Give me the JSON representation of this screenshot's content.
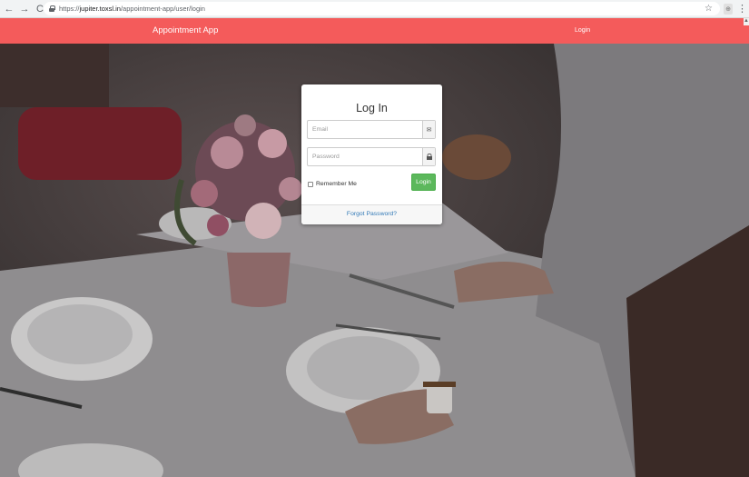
{
  "browser": {
    "url_scheme": "https://",
    "url_host": "jupiter.toxsl.in",
    "url_path": "/appointment-app/user/login",
    "back_glyph": "←",
    "forward_glyph": "→",
    "reload_glyph": "C",
    "star_glyph": "☆",
    "menu_glyph": "⋮"
  },
  "navbar": {
    "brand": "Appointment App",
    "login_link": "Login",
    "color": "#f45b5b"
  },
  "login_card": {
    "title": "Log In",
    "email_placeholder": "Email",
    "password_placeholder": "Password",
    "remember_label": "Remember Me",
    "login_button": "Login",
    "forgot_link": "Forgot Password?",
    "button_color": "#5cb85c",
    "link_color": "#337ab7"
  },
  "icons": {
    "email": "envelope-icon",
    "password": "lock-icon"
  }
}
